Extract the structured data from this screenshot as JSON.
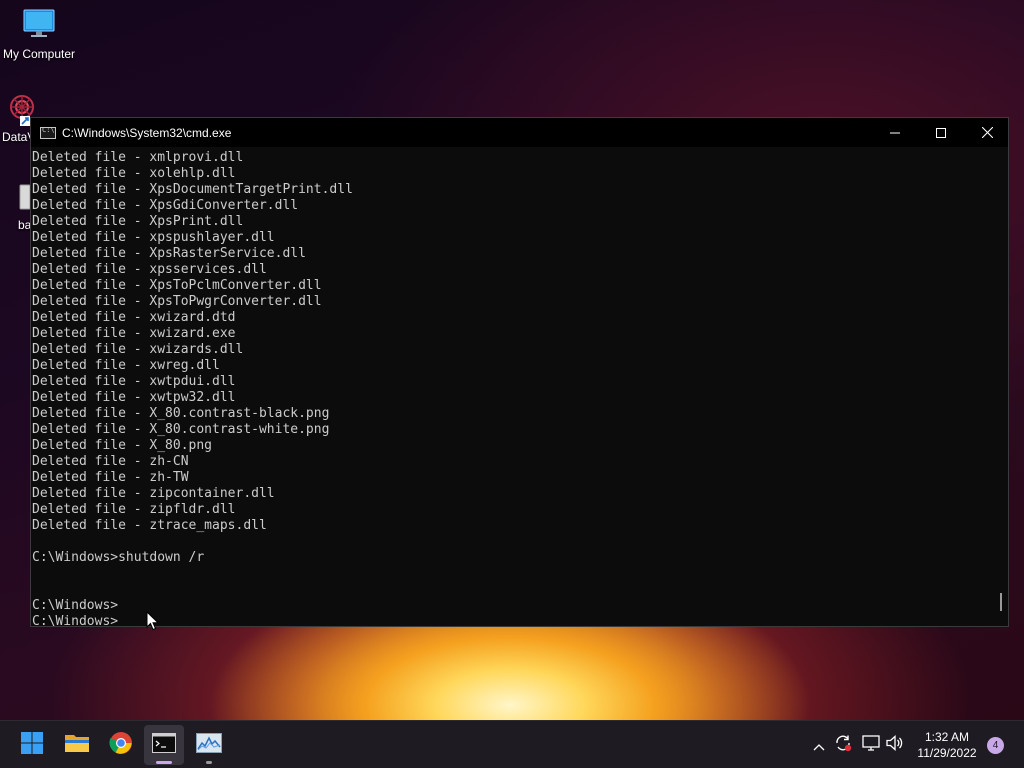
{
  "desktop": {
    "icons": [
      {
        "label": "My Computer",
        "icon": "monitor-icon"
      },
      {
        "label": "DataV",
        "icon": "dataviz-shortcut-icon"
      },
      {
        "label": "ba",
        "icon": "battery-file-icon"
      }
    ]
  },
  "cmd_window": {
    "title": "C:\\Windows\\System32\\cmd.exe",
    "controls": {
      "minimize": "minimize-icon",
      "maximize": "maximize-icon",
      "close": "close-icon"
    },
    "lines": [
      "Deleted file - xmlprovi.dll",
      "Deleted file - xolehlp.dll",
      "Deleted file - XpsDocumentTargetPrint.dll",
      "Deleted file - XpsGdiConverter.dll",
      "Deleted file - XpsPrint.dll",
      "Deleted file - xpspushlayer.dll",
      "Deleted file - XpsRasterService.dll",
      "Deleted file - xpsservices.dll",
      "Deleted file - XpsToPclmConverter.dll",
      "Deleted file - XpsToPwgrConverter.dll",
      "Deleted file - xwizard.dtd",
      "Deleted file - xwizard.exe",
      "Deleted file - xwizards.dll",
      "Deleted file - xwreg.dll",
      "Deleted file - xwtpdui.dll",
      "Deleted file - xwtpw32.dll",
      "Deleted file - X_80.contrast-black.png",
      "Deleted file - X_80.contrast-white.png",
      "Deleted file - X_80.png",
      "Deleted file - zh-CN",
      "Deleted file - zh-TW",
      "Deleted file - zipcontainer.dll",
      "Deleted file - zipfldr.dll",
      "Deleted file - ztrace_maps.dll",
      "",
      "C:\\Windows>shutdown /r",
      "",
      "",
      "C:\\Windows>",
      "C:\\Windows>"
    ]
  },
  "taskbar": {
    "apps": [
      {
        "name": "start",
        "icon": "windows-start-icon"
      },
      {
        "name": "file-explorer",
        "icon": "folder-icon"
      },
      {
        "name": "chrome",
        "icon": "chrome-icon"
      },
      {
        "name": "command-prompt",
        "icon": "terminal-icon",
        "active": true
      },
      {
        "name": "performance-monitor",
        "icon": "chart-monitor-icon"
      }
    ],
    "tray": {
      "icons": [
        "chevron-up-icon",
        "sync-alert-icon",
        "network-icon",
        "volume-icon"
      ],
      "time": "1:32 AM",
      "date": "11/29/2022",
      "notification_count": "4"
    }
  },
  "colors": {
    "console_bg": "#0c0c0c",
    "console_text": "#cccccc",
    "taskbar_bg": "#1e1b22",
    "accent": "#0078d4"
  }
}
